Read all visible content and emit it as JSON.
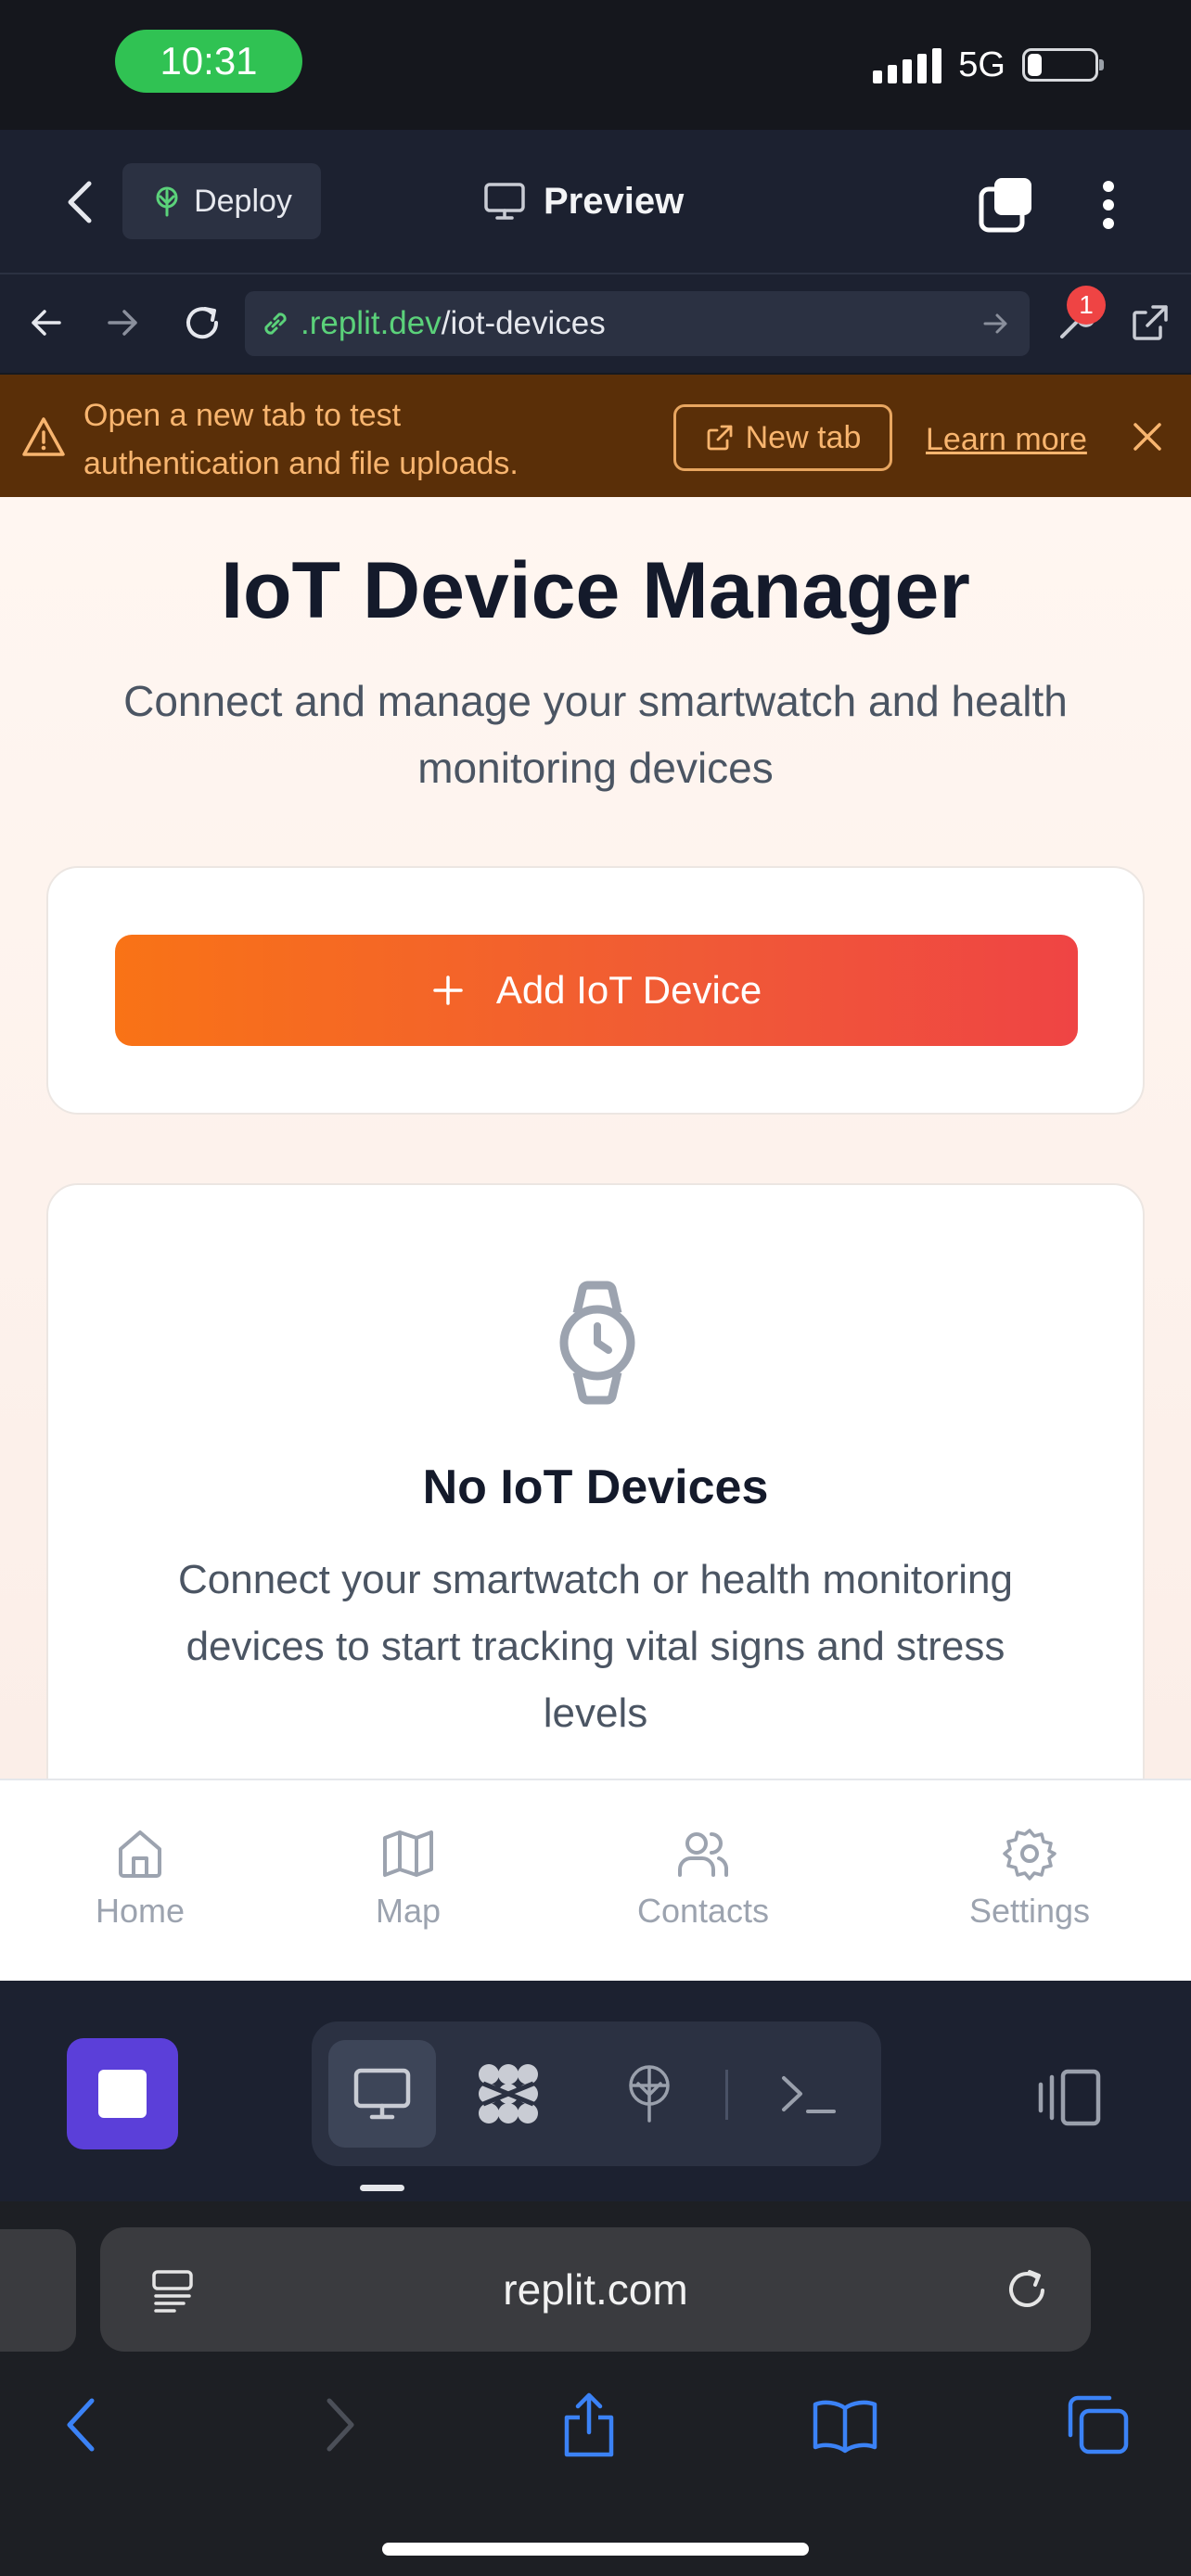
{
  "status_bar": {
    "time": "10:31",
    "network": "5G",
    "battery_level": 0.2
  },
  "replit_header": {
    "deploy_label": "Deploy",
    "preview_label": "Preview"
  },
  "browser_bar": {
    "url_domain": ".replit.dev",
    "url_path": "/iot-devices",
    "devtools_badge": "1"
  },
  "banner": {
    "line1": "Open a new tab to test",
    "line2": "authentication and file uploads.",
    "new_tab_label": "New tab",
    "learn_more_label": "Learn more"
  },
  "page": {
    "title": "IoT Device Manager",
    "subtitle": "Connect and manage your smartwatch and health monitoring devices",
    "add_button_label": "Add IoT Device",
    "empty_title": "No IoT Devices",
    "empty_description": "Connect your smartwatch or health monitoring devices to start tracking vital signs and stress levels"
  },
  "app_nav": {
    "items": [
      {
        "label": "Home",
        "icon": "home-icon"
      },
      {
        "label": "Map",
        "icon": "map-icon"
      },
      {
        "label": "Contacts",
        "icon": "users-icon"
      },
      {
        "label": "Settings",
        "icon": "gear-icon"
      }
    ]
  },
  "safari": {
    "url": "replit.com"
  },
  "colors": {
    "accent_orange": "#f97316",
    "accent_red": "#ef4444",
    "replit_purple": "#5b3fd9",
    "url_green": "#5bd27a",
    "banner_bg": "#5a2f08"
  }
}
